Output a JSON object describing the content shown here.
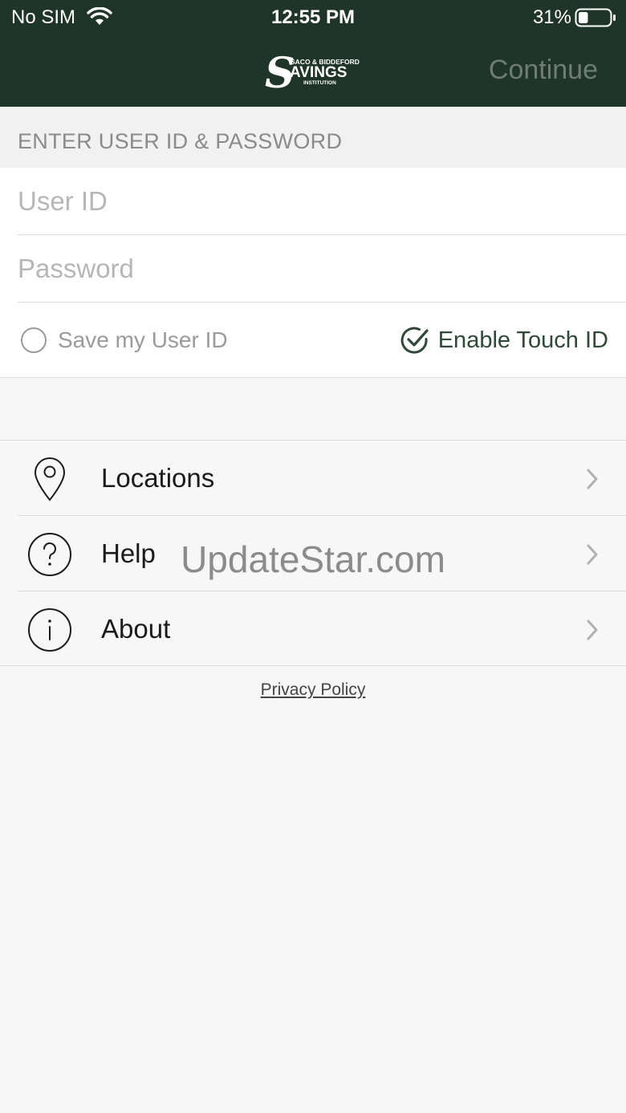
{
  "status_bar": {
    "carrier": "No SIM",
    "time": "12:55 PM",
    "battery_percent": "31%",
    "battery_level": 0.31
  },
  "header": {
    "logo_text": {
      "top": "SACO & BIDDEFORD",
      "main": "AVINGS",
      "initial": "S",
      "bottom": "INSTITUTION"
    },
    "continue_label": "Continue",
    "background_color": "#1f3529"
  },
  "login": {
    "section_title": "ENTER USER ID & PASSWORD",
    "user_id_placeholder": "User ID",
    "password_placeholder": "Password",
    "save_user_id_label": "Save my User ID",
    "save_user_id_checked": false,
    "touch_id_label": "Enable Touch ID",
    "touch_id_checked": true
  },
  "menu": {
    "items": [
      {
        "label": "Locations",
        "icon": "location-pin-icon"
      },
      {
        "label": "Help",
        "icon": "question-circle-icon"
      },
      {
        "label": "About",
        "icon": "info-circle-icon"
      }
    ]
  },
  "watermark": "UpdateStar.com",
  "footer": {
    "privacy_policy": "Privacy Policy"
  }
}
